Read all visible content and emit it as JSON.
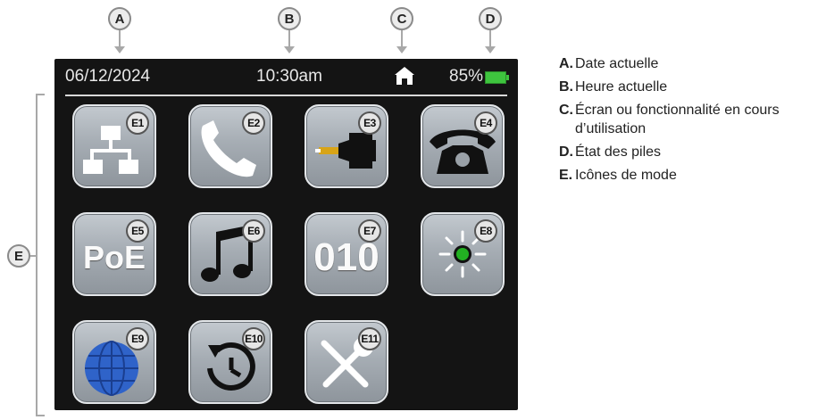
{
  "callouts": {
    "a": "A",
    "b": "B",
    "c": "C",
    "d": "D",
    "e": "E"
  },
  "status": {
    "date": "06/12/2024",
    "time": "10:30am",
    "battery": "85%",
    "battery_level": 0.85
  },
  "tiles": [
    {
      "id": "E1",
      "icon": "network-icon"
    },
    {
      "id": "E2",
      "icon": "phone-icon"
    },
    {
      "id": "E3",
      "icon": "cable-probe-icon"
    },
    {
      "id": "E4",
      "icon": "desk-phone-icon"
    },
    {
      "id": "E5",
      "icon": "poe-icon",
      "text": "PoE"
    },
    {
      "id": "E6",
      "icon": "music-notes-icon"
    },
    {
      "id": "E7",
      "icon": "binary-icon",
      "text": "010"
    },
    {
      "id": "E8",
      "icon": "blinking-light-icon"
    },
    {
      "id": "E9",
      "icon": "globe-icon"
    },
    {
      "id": "E10",
      "icon": "history-icon"
    },
    {
      "id": "E11",
      "icon": "tools-icon"
    }
  ],
  "legend": [
    {
      "letter": "A.",
      "text": "Date actuelle"
    },
    {
      "letter": "B.",
      "text": "Heure actuelle"
    },
    {
      "letter": "C.",
      "text": "Écran ou fonctionnalité en cours d’utilisation"
    },
    {
      "letter": "D.",
      "text": "État des piles"
    },
    {
      "letter": "E.",
      "text": "Icônes de mode"
    }
  ],
  "colors": {
    "screen": "#141414",
    "tile": "#a6adb4",
    "battery": "#3ec43e",
    "led": "#22b022",
    "globe": "#2f63c9"
  }
}
